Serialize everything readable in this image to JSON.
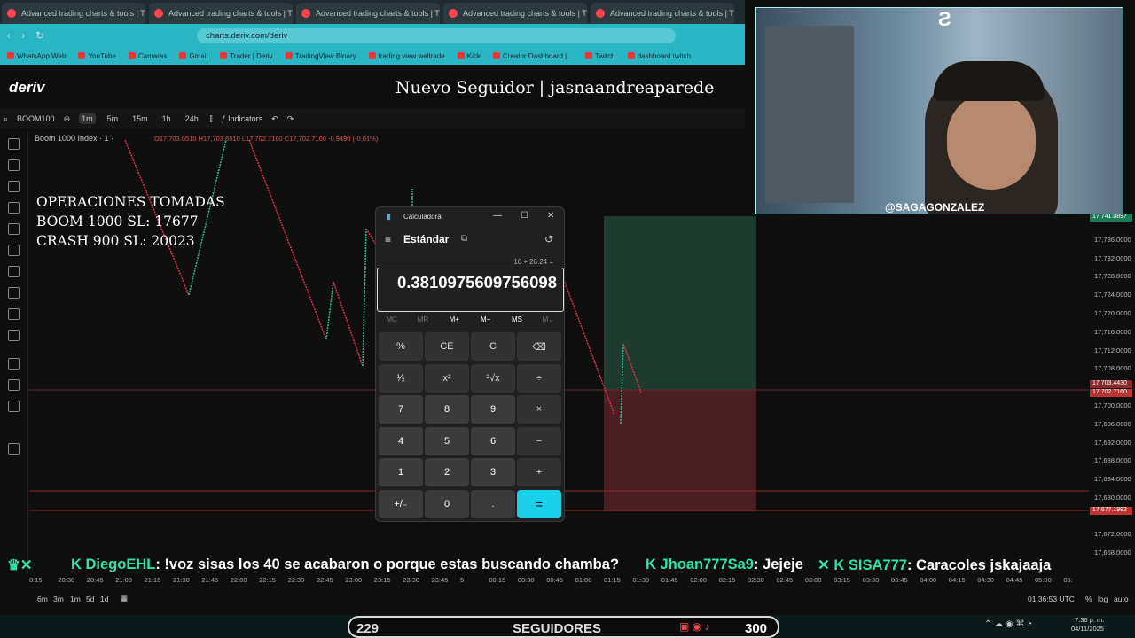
{
  "browser": {
    "tabs": [
      {
        "title": "Advanced trading charts & tools | Tr"
      },
      {
        "title": "Advanced trading charts & tools | Tr"
      },
      {
        "title": "Advanced trading charts & tools | Tr"
      },
      {
        "title": "Advanced trading charts & tools | Tr"
      },
      {
        "title": "Advanced trading charts & tools | Tr"
      }
    ],
    "url": "charts.deriv.com/deriv",
    "bookmarks": [
      "WhatsApp Web",
      "YouTube",
      "Camaras",
      "Gmail",
      "Trader | Deriv",
      "TradingView Binary",
      "trading view weltrade",
      "Kick",
      "Creator Dashboard |...",
      "Twitch",
      "dashboard twitch"
    ]
  },
  "deriv": {
    "logo": "deriv",
    "overlay_follower": "Nuevo Seguidor | jasnaandreaparede"
  },
  "chart_toolbar": {
    "symbol": "BOOM100",
    "timeframes": [
      "1m",
      "5m",
      "15m",
      "1h",
      "24h"
    ],
    "indicators": "Indicators"
  },
  "chart_header": {
    "symbol_label": "Boom 1000 Index · 1 ·",
    "ohlc": "O17,703.6510 H17,703.6510 L17,702.7160 C17,702.7160 -0.9490 (-0.01%)"
  },
  "overlay_ops": {
    "line1": "OPERACIONES TOMADAS",
    "line2": "BOOM 1000 SL: 17677",
    "line3": "CRASH 900 SL: 20023"
  },
  "price_axis": {
    "labels": [
      "17,736.0000",
      "17,732.0000",
      "17,728.0000",
      "17,724.0000",
      "17,720.0000",
      "17,716.0000",
      "17,712.0000",
      "17,708.0000",
      "17,700.0000",
      "17,696.0000",
      "17,692.0000",
      "17,688.0000",
      "17,684.0000",
      "17,680.0000",
      "17,672.0000",
      "17,668.0000"
    ],
    "tags": [
      {
        "text": "17,741.0897",
        "color": "#1f7a5a"
      },
      {
        "text": "17,703.4430",
        "color": "#8a2a2a"
      },
      {
        "text": "17,702.7160",
        "color": "#c03333"
      },
      {
        "text": "17,677.1992",
        "color": "#c03333"
      }
    ]
  },
  "time_axis": [
    "0:15",
    "20:30",
    "20:45",
    "21:00",
    "21:15",
    "21:30",
    "21:45",
    "22:00",
    "22:15",
    "22:30",
    "22:45",
    "23:00",
    "23:15",
    "23:30",
    "23:45",
    "5",
    "00:15",
    "00:30",
    "00:45",
    "01:00",
    "01:15",
    "01:30",
    "01:45",
    "02:00",
    "02:15",
    "02:30",
    "02:45",
    "03:00",
    "03:15",
    "03:30",
    "03:45",
    "04:00",
    "04:15",
    "04:30",
    "04:45",
    "05:00",
    "05:"
  ],
  "bottom_bar": {
    "ranges": [
      "6m",
      "3m",
      "1m",
      "5d",
      "1d"
    ],
    "clock": "01:36:53 UTC",
    "pct": "%",
    "log": "log",
    "auto": "auto"
  },
  "taskbar": {
    "time": "7:36 p. m.",
    "date": "04/11/2025"
  },
  "calculator": {
    "title": "Calculadora",
    "mode": "Estándar",
    "expression": "10 ÷ 26.24 =",
    "result": "0.3810975609756098",
    "memory": [
      "MC",
      "MR",
      "M+",
      "M−",
      "MS",
      "M⌄"
    ],
    "keys": [
      [
        "%",
        "CE",
        "C",
        "⌫"
      ],
      [
        "¹⁄ₓ",
        "x²",
        "²√x",
        "÷"
      ],
      [
        "7",
        "8",
        "9",
        "×"
      ],
      [
        "4",
        "5",
        "6",
        "−"
      ],
      [
        "1",
        "2",
        "3",
        "+"
      ],
      [
        "+/₋",
        "0",
        ".",
        "="
      ]
    ]
  },
  "ticker": {
    "messages": [
      {
        "user": "DiegoEHL",
        "text": ": !voz sisas los 40 se acabaron o porque estas buscando chamba?"
      },
      {
        "user": "Jhoan777Sa9",
        "text": ": Jejeje"
      },
      {
        "user": "SISA777",
        "text": ": Caracoles jskajaaja"
      }
    ]
  },
  "webcam": {
    "handle": "@SAGAGONZALEZ"
  },
  "follow_bar": {
    "current": "229",
    "label": "SEGUIDORES",
    "goal": "300"
  },
  "colors": {
    "deriv_red": "#ff444f",
    "accent_cyan": "#1ad0e8",
    "candle_up": "#2fbf8f",
    "candle_down": "#e0304a"
  }
}
